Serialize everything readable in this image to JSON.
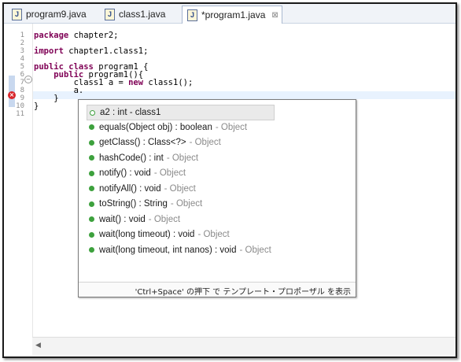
{
  "tabs": [
    {
      "label": "program9.java",
      "icon": "java-file-icon"
    },
    {
      "label": "class1.java",
      "icon": "java-file-icon"
    },
    {
      "label": "*program1.java",
      "icon": "java-file-icon",
      "active": true,
      "close": "⊠"
    }
  ],
  "lines": [
    {
      "num": "1",
      "parts": [
        {
          "k": "package"
        },
        {
          "t": " chapter2;"
        }
      ]
    },
    {
      "num": "2",
      "parts": []
    },
    {
      "num": "3",
      "parts": [
        {
          "k": "import"
        },
        {
          "t": " chapter1.class1;"
        }
      ]
    },
    {
      "num": "4",
      "parts": []
    },
    {
      "num": "5",
      "parts": [
        {
          "k": "public"
        },
        {
          "t": " "
        },
        {
          "k": "class"
        },
        {
          "t": " program1 {"
        }
      ]
    },
    {
      "num": "6",
      "parts": [
        {
          "t": "    "
        },
        {
          "k": "public"
        },
        {
          "t": " program1(){"
        }
      ]
    },
    {
      "num": "7",
      "parts": [
        {
          "t": "        class1 a = "
        },
        {
          "k": "new"
        },
        {
          "t": " class1();"
        }
      ]
    },
    {
      "num": "8",
      "parts": [
        {
          "t": "        a."
        }
      ]
    },
    {
      "num": "9",
      "parts": [
        {
          "t": "    }"
        }
      ]
    },
    {
      "num": "10",
      "parts": [
        {
          "t": "}"
        }
      ]
    },
    {
      "num": "11",
      "parts": []
    }
  ],
  "error_marker": "×",
  "fold_marker": "−",
  "scroll_left": "◀",
  "proposals": [
    {
      "main": "a2 : int - class1",
      "owner": "",
      "selected": true,
      "hollow": true
    },
    {
      "main": "equals(Object obj) : boolean",
      "owner": "- Object"
    },
    {
      "main": "getClass() : Class<?>",
      "owner": "- Object"
    },
    {
      "main": "hashCode() : int",
      "owner": "- Object"
    },
    {
      "main": "notify() : void",
      "owner": "- Object"
    },
    {
      "main": "notifyAll() : void",
      "owner": "- Object"
    },
    {
      "main": "toString() : String",
      "owner": "- Object"
    },
    {
      "main": "wait() : void",
      "owner": "- Object"
    },
    {
      "main": "wait(long timeout) : void",
      "owner": "- Object"
    },
    {
      "main": "wait(long timeout, int nanos) : void",
      "owner": "- Object"
    }
  ],
  "footer_hint": "'Ctrl+Space' の押下 で テンプレート・プロポーザル を表示"
}
